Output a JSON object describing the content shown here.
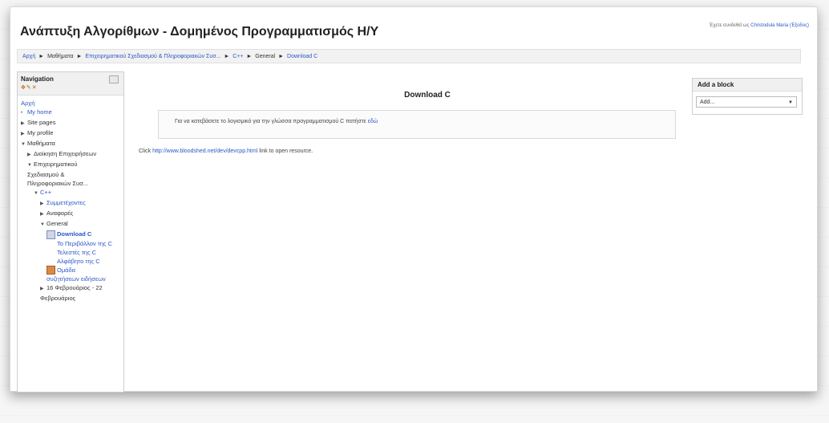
{
  "header": {
    "title": "Ανάπτυξη Αλγορίθμων - Δομημένος Προγραμματισμός Η/Υ",
    "login_prefix": "Έχετε συνδεθεί ως",
    "login_user": "Christodula Maria (Έξοδος)"
  },
  "breadcrumb": {
    "items": [
      "Αρχή",
      "Μαθήματα",
      "Επιχειρηματικού Σχεδιασμού & Πληροφοριακών Συσ...",
      "C++",
      "General",
      "Download C"
    ]
  },
  "navigation": {
    "title": "Navigation",
    "items": {
      "home": "Αρχή",
      "my_home": "My home",
      "site_pages": "Site pages",
      "my_profile": "My profile",
      "courses": "Μαθήματα",
      "admin": "Διοίκηση Επιχειρήσεων",
      "category": "Επιχειρηματικού Σχεδιασμού & Πληροφοριακών Συσ...",
      "cpp": "C++",
      "participants": "Συμμετέχοντες",
      "reports": "Αναφορές",
      "general": "General",
      "download_c": "Download C",
      "res1": "Το Περιβάλλον της C",
      "res2": "Τελεστές της C",
      "res3": "Αλφάβητο της C",
      "forum": "Ομάδα συζητήσεων ειδήσεων",
      "week": "16 Φεβρουάριος - 22 Φεβρουάριος"
    }
  },
  "main": {
    "title": "Download C",
    "intro_text": "Για να κατεβάσετε το λογισμικό για την γλώσσα προγραμματισμού C πατήστε",
    "intro_link": "εδώ",
    "click_prefix": "Click",
    "click_url": "http://www.bloodshed.net/dev/devcpp.html",
    "click_suffix": "link to open resource."
  },
  "add_block": {
    "title": "Add a block",
    "selected": "Add..."
  }
}
